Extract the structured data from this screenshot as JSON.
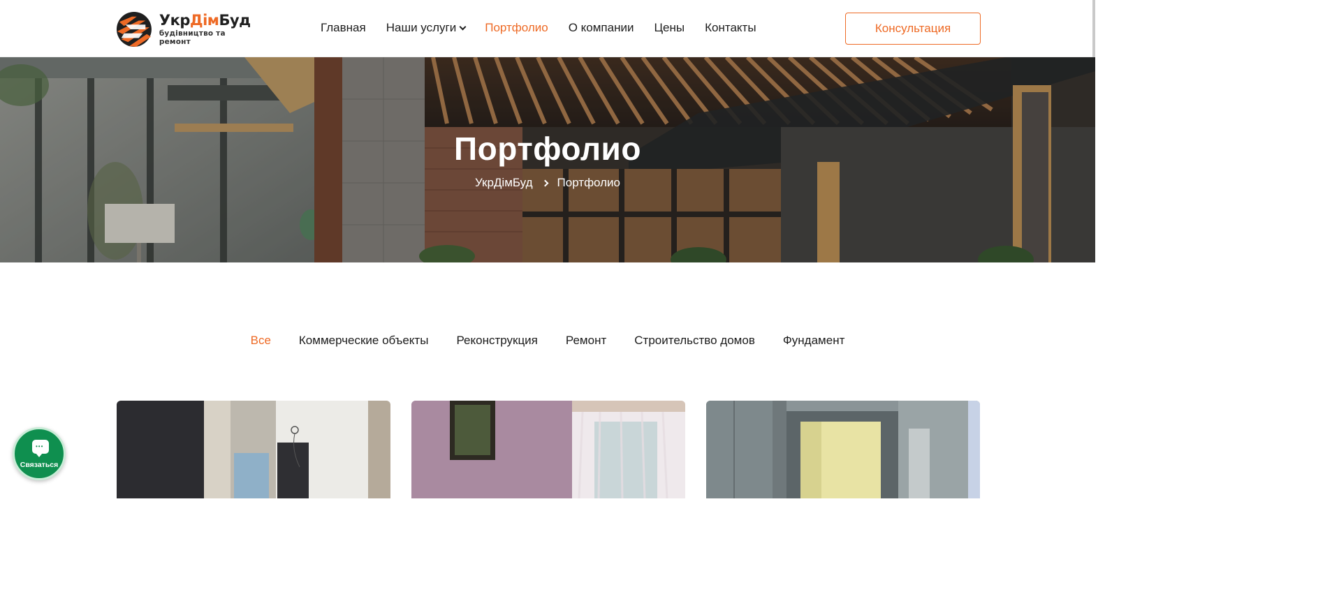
{
  "brand": {
    "name_part1": "Укр",
    "name_accent": "Дім",
    "name_part2": "Буд",
    "tagline": "будівництво та ремонт",
    "accent_color": "#ee6a25"
  },
  "nav": {
    "items": [
      {
        "label": "Главная",
        "active": false,
        "has_dropdown": false
      },
      {
        "label": "Наши услуги",
        "active": false,
        "has_dropdown": true
      },
      {
        "label": "Портфолио",
        "active": true,
        "has_dropdown": false
      },
      {
        "label": "О компании",
        "active": false,
        "has_dropdown": false
      },
      {
        "label": "Цены",
        "active": false,
        "has_dropdown": false
      },
      {
        "label": "Контакты",
        "active": false,
        "has_dropdown": false
      }
    ],
    "cta_label": "Консультация"
  },
  "hero": {
    "title": "Портфолио",
    "breadcrumb": [
      "УкрДімБуд",
      "Портфолио"
    ]
  },
  "filters": {
    "items": [
      {
        "label": "Все",
        "active": true
      },
      {
        "label": "Коммерческие объекты",
        "active": false
      },
      {
        "label": "Реконструкция",
        "active": false
      },
      {
        "label": "Ремонт",
        "active": false
      },
      {
        "label": "Строительство домов",
        "active": false
      },
      {
        "label": "Фундамент",
        "active": false
      }
    ]
  },
  "portfolio": {
    "cards": [
      {
        "icon": "wardrobe-room-photo"
      },
      {
        "icon": "bedroom-window-photo"
      },
      {
        "icon": "office-door-photo"
      }
    ]
  },
  "chat_widget": {
    "label": "Связаться",
    "color": "#0f8f4f"
  }
}
